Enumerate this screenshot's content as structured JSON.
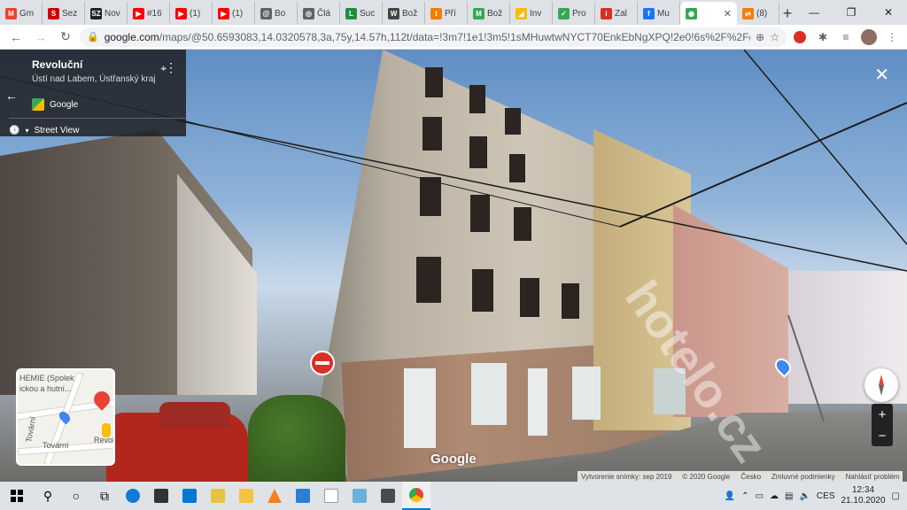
{
  "browser": {
    "tabs": [
      {
        "label": "Gm",
        "icon": "gmail-icon",
        "color": "#ea4335",
        "glyph": "M"
      },
      {
        "label": "Sez",
        "icon": "seznam-icon",
        "color": "#cc0000",
        "glyph": "S"
      },
      {
        "label": "Nov",
        "icon": "sz-icon",
        "color": "#222222",
        "glyph": "SZ"
      },
      {
        "label": "#16",
        "icon": "youtube-icon",
        "color": "#ff0000",
        "glyph": "▶"
      },
      {
        "label": "(1)",
        "icon": "youtube-icon",
        "color": "#ff0000",
        "glyph": "▶"
      },
      {
        "label": "(1)",
        "icon": "youtube-icon",
        "color": "#ff0000",
        "glyph": "▶"
      },
      {
        "label": "Bo",
        "icon": "globe-icon",
        "color": "#5f6368",
        "glyph": "@"
      },
      {
        "label": "Člá",
        "icon": "globe-icon",
        "color": "#5f6368",
        "glyph": "◎"
      },
      {
        "label": "Suc",
        "icon": "letter-l-icon",
        "color": "#1e8e3e",
        "glyph": "L"
      },
      {
        "label": "Bož",
        "icon": "wikipedia-icon",
        "color": "#444444",
        "glyph": "W"
      },
      {
        "label": "Pří",
        "icon": "tool-icon",
        "color": "#f57c00",
        "glyph": "t"
      },
      {
        "label": "Bož",
        "icon": "m-icon",
        "color": "#34a853",
        "glyph": "M"
      },
      {
        "label": "Inv",
        "icon": "folder-icon",
        "color": "#fbbc04",
        "glyph": "◢"
      },
      {
        "label": "Pro",
        "icon": "check-icon",
        "color": "#34a853",
        "glyph": "✓"
      },
      {
        "label": "Zal",
        "icon": "info-icon",
        "color": "#d93025",
        "glyph": "i"
      },
      {
        "label": "Mu",
        "icon": "facebook-icon",
        "color": "#1877f2",
        "glyph": "f"
      },
      {
        "label": "",
        "icon": "google-maps-icon",
        "color": "#34a853",
        "glyph": "◉",
        "active": true
      },
      {
        "label": "(8)",
        "icon": "arrows-icon",
        "color": "#f57c00",
        "glyph": "⇄"
      }
    ],
    "url_host": "google.com",
    "url_path": "/maps/@50.6593083,14.0320578,3a,75y,14.57h,112t/data=!3m7!1e1!3m5!1sMHuwtwNYCT70EnkEbNgXPQ!2e0!6s%2F%2Fgeo2.ggp..."
  },
  "streetview": {
    "place_title": "Revoluční",
    "place_address": "Ústí nad Labem, Ústřanský kraj",
    "provider": "Google",
    "mode_label": "Street View",
    "minimap": {
      "label_1": "HEMIE (Spolek",
      "label_2": "ickou a hutní...",
      "street_1": "Tovární",
      "street_2": "Tovární",
      "street_3": "Revolu"
    },
    "logo_text": "Google",
    "footer": {
      "capture": "Vytvorenie snímky: sep 2019",
      "copyright": "© 2020 Google",
      "country": "Česko",
      "terms": "Zmluvné podmienky",
      "report": "Nahlásiť problém"
    },
    "watermark": "hotelo.cz"
  },
  "taskbar": {
    "language": "CES",
    "time": "12:34",
    "date": "21.10.2020"
  }
}
